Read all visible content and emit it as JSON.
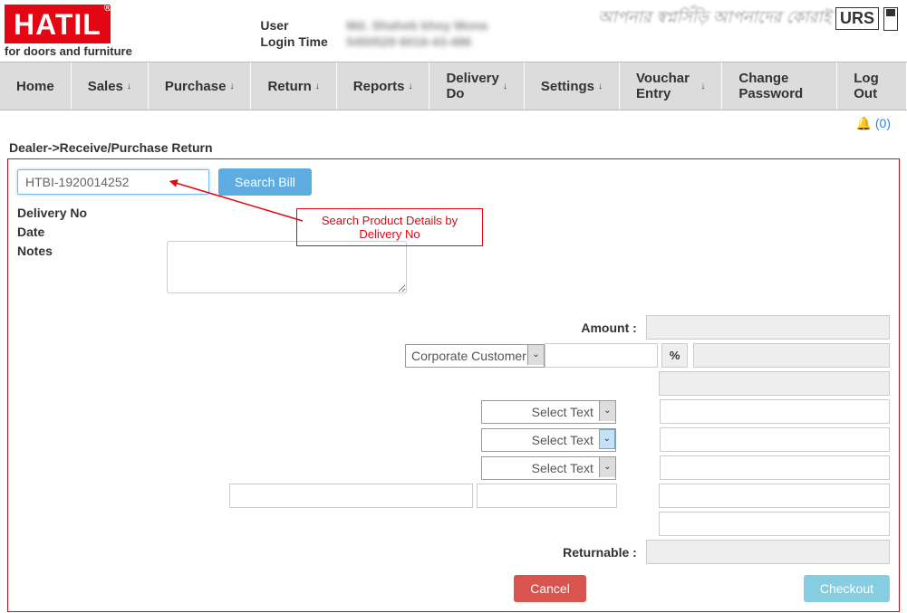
{
  "header": {
    "logo_text": "HATIL",
    "logo_reg": "®",
    "logo_sub": "for doors and furniture",
    "user_label": "User",
    "user_value": "Md. Shaheb khoy Mona",
    "login_label": "Login Time",
    "login_value": "5450529 6016-43-486",
    "script": "আপনার স্বপ্নসিঁড়ি আপনাদের কোরাই",
    "urs": "URS"
  },
  "nav": {
    "home": "Home",
    "sales": "Sales",
    "purchase": "Purchase",
    "return": "Return",
    "reports": "Reports",
    "delivery": "Delivery Do",
    "settings": "Settings",
    "voucher": "Vouchar Entry",
    "password": "Change Password",
    "logout": "Log Out"
  },
  "notif": {
    "count": "(0)"
  },
  "breadcrumb": "Dealer->Receive/Purchase Return",
  "search": {
    "input_value": "HTBI-1920014252",
    "button": "Search Bill"
  },
  "annotation": "Search Product Details by Delivery No",
  "form": {
    "delivery_no": "Delivery No",
    "date": "Date",
    "notes": "Notes"
  },
  "amount": {
    "label": "Amount :",
    "dropdown1": "Corporate Customer D",
    "percent": "%",
    "select_text": "Select Text",
    "returnable": "Returnable :"
  },
  "buttons": {
    "cancel": "Cancel",
    "checkout": "Checkout"
  }
}
